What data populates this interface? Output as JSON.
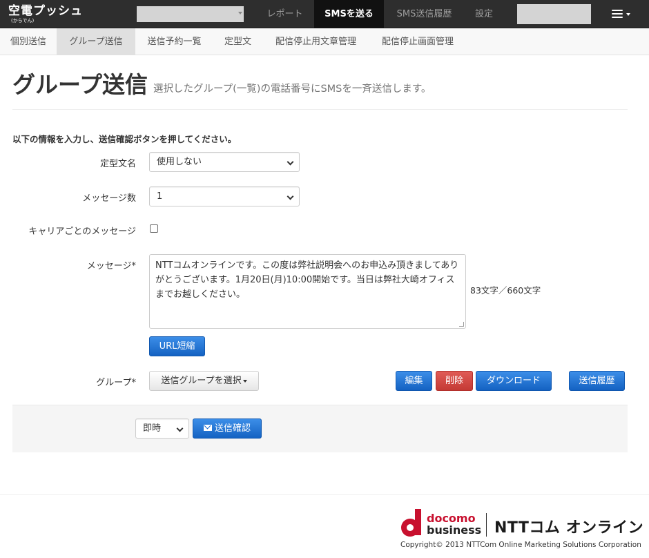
{
  "brand": {
    "name": "空電プッシュ",
    "reading": "(からでん)"
  },
  "topnav": {
    "report": "レポート",
    "send_sms": "SMSを送る",
    "history": "SMS送信履歴",
    "settings": "設定"
  },
  "subnav": [
    "個別送信",
    "グループ送信",
    "送信予約一覧",
    "定型文",
    "配信停止用文章管理",
    "配信停止画面管理"
  ],
  "page": {
    "title": "グループ送信",
    "description": "選択したグループ(一覧)の電話番号にSMSを一斉送信します。",
    "instruction": "以下の情報を入力し、送信確認ボタンを押してください。"
  },
  "form": {
    "template_label": "定型文名",
    "template_value": "使用しない",
    "message_count_label": "メッセージ数",
    "message_count_value": "1",
    "carrier_label": "キャリアごとのメッセージ",
    "message_label": "メッセージ*",
    "message_text": "NTTコムオンラインです。この度は弊社説明会へのお申込み頂きましてありがとうございます。1月20日(月)10:00開始です。当日は弊社大崎オフィスまでお越しください。",
    "char_count": "83文字／660文字",
    "url_shorten_button": "URL短縮",
    "group_label": "グループ*",
    "group_select_button": "送信グループを選択",
    "edit_button": "編集",
    "delete_button": "削除",
    "download_button": "ダウンロード",
    "send_history_button": "送信履歴",
    "timing_value": "即時",
    "confirm_button": "送信確認"
  },
  "footer": {
    "logo_line1": "docomo",
    "logo_line2": "business",
    "company_logo": "NTTコム オンライン",
    "copyright": "Copyright© 2013 NTTCom Online Marketing Solutions Corporation"
  },
  "colors": {
    "navbar": "#2e2e2e",
    "primary": "#2374d6",
    "danger": "#d9534f",
    "docomo_red": "#c8102e"
  }
}
